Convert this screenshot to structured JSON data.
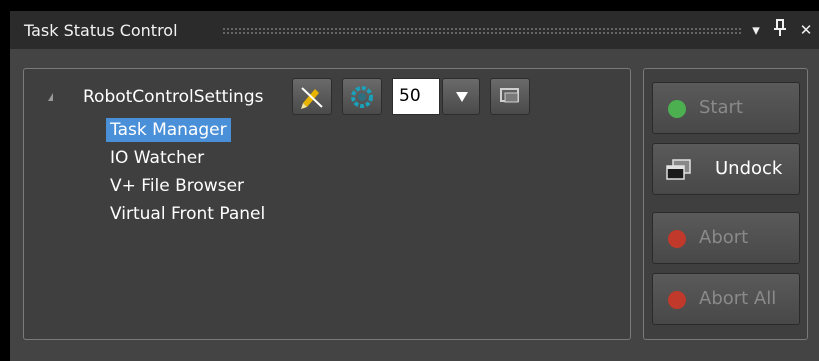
{
  "window": {
    "title": "Task Status Control",
    "dropdown_icon": "▾",
    "pin_icon": "ᛘ",
    "close_icon": "✕"
  },
  "tree": {
    "root_label": "RobotControlSettings",
    "items": [
      {
        "label": "Task Manager",
        "selected": true
      },
      {
        "label": "IO Watcher",
        "selected": false
      },
      {
        "label": "V+ File Browser",
        "selected": false
      },
      {
        "label": "Virtual Front Panel",
        "selected": false
      }
    ]
  },
  "toolbar": {
    "speed_value": "50"
  },
  "side_buttons": {
    "start_label": "Start",
    "undock_label": "Undock",
    "abort_label": "Abort",
    "abort_all_label": "Abort All"
  },
  "colors": {
    "selection": "#4a90d9",
    "start_dot": "#4caf50",
    "abort_dot": "#c0392b",
    "panel_bg": "#3f3f3f"
  }
}
